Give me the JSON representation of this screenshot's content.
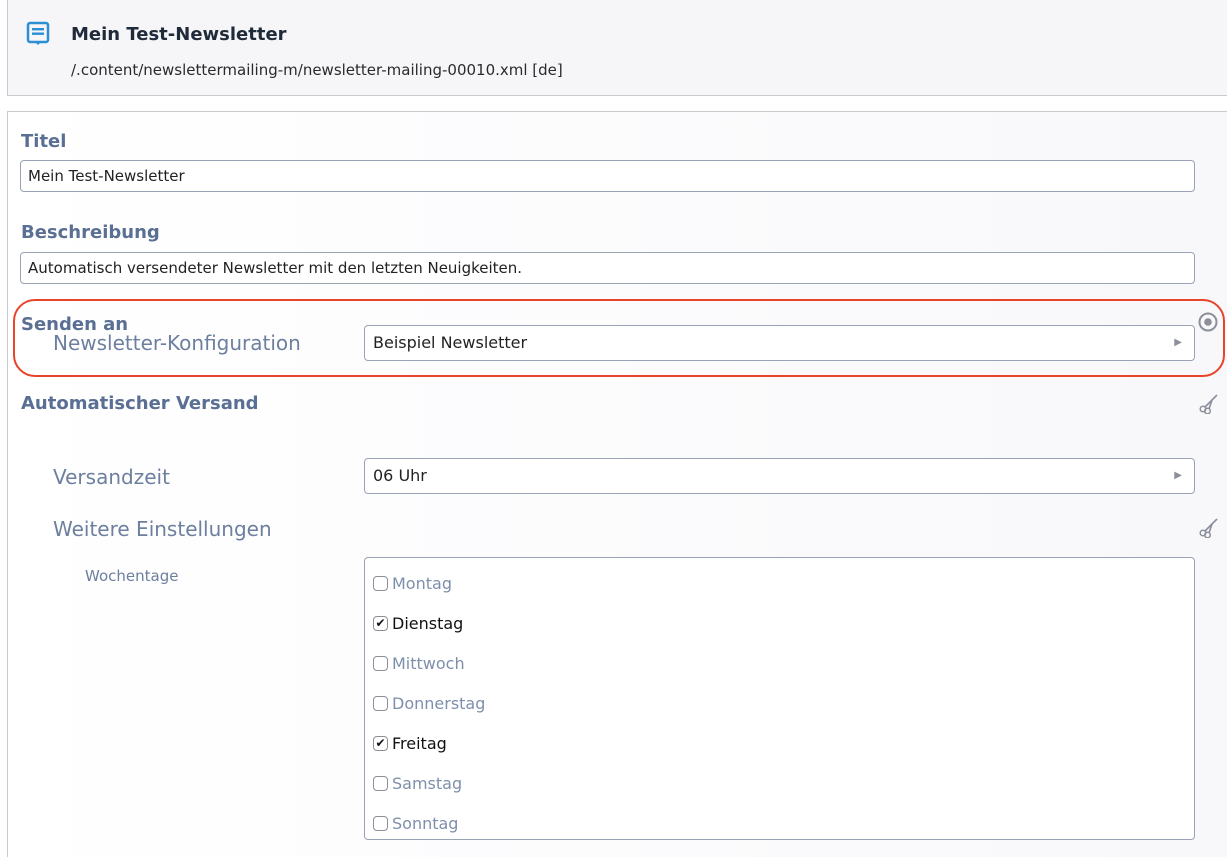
{
  "header": {
    "title": "Mein Test-Newsletter",
    "path": "/.content/newslettermailing-m/newsletter-mailing-00010.xml [de]",
    "icon": "newsletter-document-icon"
  },
  "form": {
    "titel": {
      "label": "Titel",
      "value": "Mein Test-Newsletter"
    },
    "beschreibung": {
      "label": "Beschreibung",
      "value": "Automatisch versendeter Newsletter mit den letzten Neuigkeiten."
    },
    "senden_an": {
      "label": "Senden an",
      "config_label": "Newsletter-Konfiguration",
      "config_value": "Beispiel Newsletter"
    },
    "versand": {
      "label": "Automatischer Versand",
      "zeit_label": "Versandzeit",
      "zeit_value": "06 Uhr",
      "weitere_label": "Weitere Einstellungen",
      "wochentage_label": "Wochentage",
      "days": [
        {
          "label": "Montag",
          "checked": false
        },
        {
          "label": "Dienstag",
          "checked": true
        },
        {
          "label": "Mittwoch",
          "checked": false
        },
        {
          "label": "Donnerstag",
          "checked": false
        },
        {
          "label": "Freitag",
          "checked": true
        },
        {
          "label": "Samstag",
          "checked": false
        },
        {
          "label": "Sonntag",
          "checked": false
        }
      ]
    }
  },
  "colors": {
    "accent": "#2c8fd6",
    "label": "#5a6f94",
    "highlight": "#e8442a"
  }
}
